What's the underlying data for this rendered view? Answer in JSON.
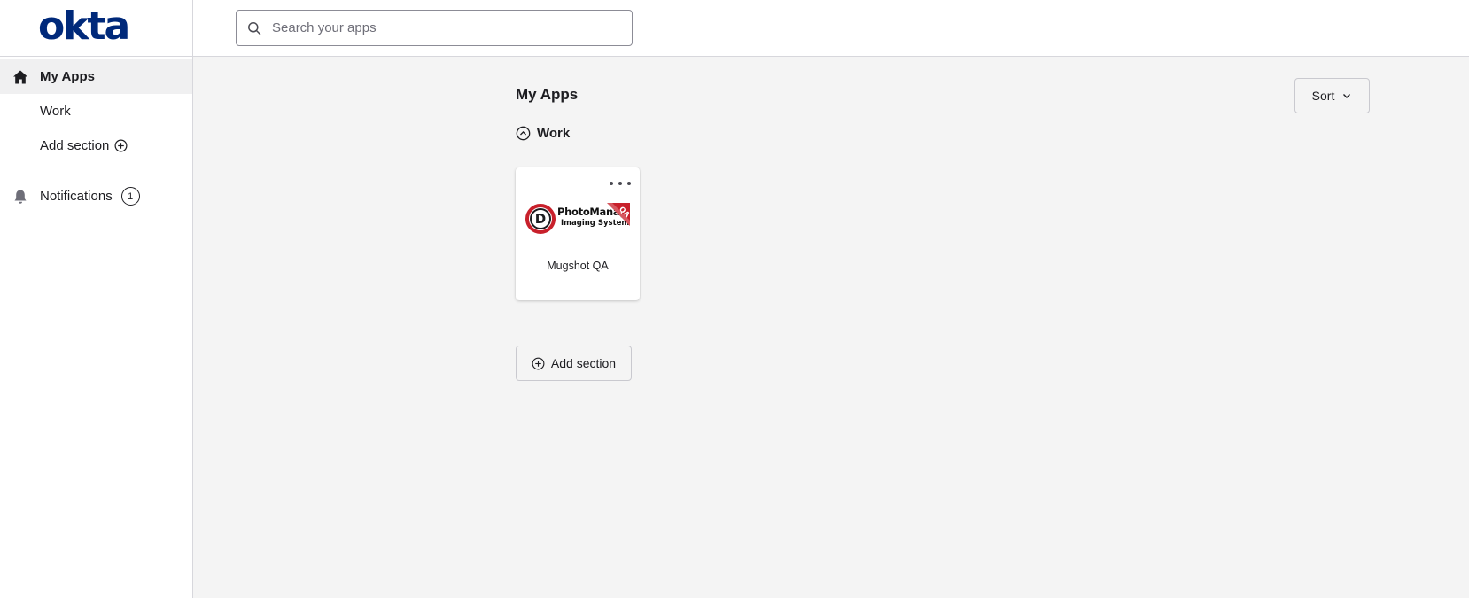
{
  "brand": {
    "logo_text": "okta",
    "color": "#00297a"
  },
  "sidebar": {
    "items": [
      {
        "label": "My Apps",
        "icon": "home-icon",
        "active": true
      },
      {
        "label": "Work",
        "icon": "",
        "active": false
      },
      {
        "label": "Add section",
        "icon": "add-circle-icon",
        "active": false
      },
      {
        "label": "Notifications",
        "icon": "bell-icon",
        "active": false,
        "badge": "1"
      }
    ]
  },
  "header": {
    "search": {
      "placeholder": "Search your apps",
      "value": ""
    }
  },
  "main": {
    "title": "My Apps",
    "sort_label": "Sort",
    "section": {
      "title": "Work",
      "apps": [
        {
          "name": "Mugshot QA",
          "logo_brand": "PhotoManager",
          "logo_sub": "Imaging System",
          "logo_letter": "D",
          "logo_ribbon": "QA",
          "logo_color": "#c8202b"
        }
      ]
    },
    "add_section_label": "Add section"
  }
}
